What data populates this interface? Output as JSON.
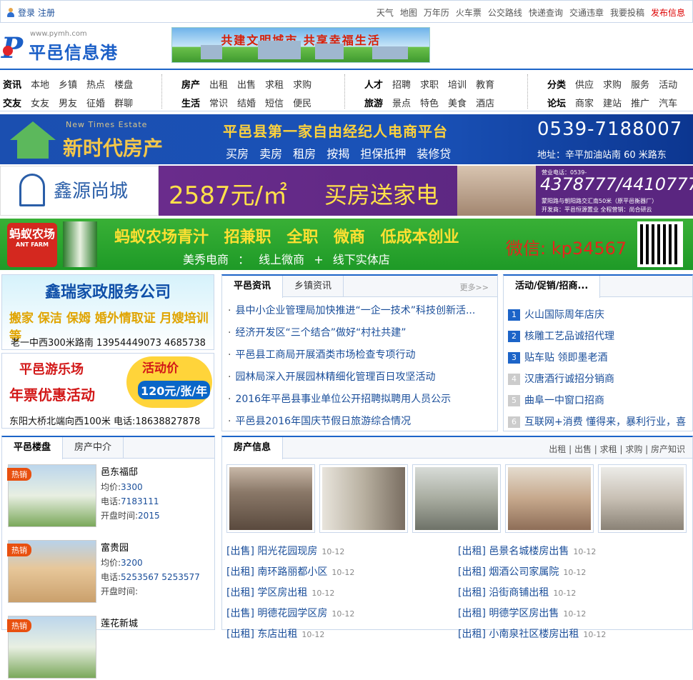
{
  "topbar": {
    "login": "登录",
    "register": "注册",
    "links": [
      "天气",
      "地图",
      "万年历",
      "火车票",
      "公交路线",
      "快递查询",
      "交通违章",
      "我要投稿"
    ],
    "publish": "发布信息"
  },
  "logo": {
    "url": "www.pymh.com",
    "name": "平邑信息港"
  },
  "slogan": "共建文明城市  共享幸福生活",
  "nav": {
    "g1": {
      "r1": [
        "资讯",
        "本地",
        "乡镇",
        "热点",
        "楼盘"
      ],
      "r2": [
        "交友",
        "女友",
        "男友",
        "征婚",
        "群聊"
      ]
    },
    "g2": {
      "r1": [
        "房产",
        "出租",
        "出售",
        "求租",
        "求购"
      ],
      "r2": [
        "生活",
        "常识",
        "结婚",
        "短信",
        "便民"
      ]
    },
    "g3": {
      "r1": [
        "人才",
        "招聘",
        "求职",
        "培训",
        "教育"
      ],
      "r2": [
        "旅游",
        "景点",
        "特色",
        "美食",
        "酒店"
      ]
    },
    "g4": {
      "r1": [
        "分类",
        "供应",
        "求购",
        "服务",
        "活动"
      ],
      "r2": [
        "论坛",
        "商家",
        "建站",
        "推广",
        "汽车"
      ]
    }
  },
  "banner1": {
    "eng": "New Times Estate",
    "name": "新时代房产",
    "headline": "平邑县第一家自由经纪人电商平台",
    "services": "买房 卖房 租房 按揭 担保抵押 装修贷",
    "phone": "0539-7188007",
    "address": "地址：辛平加油站南 60 米路东"
  },
  "banner2": {
    "name": "鑫源尚城",
    "price": "2587元/㎡",
    "gift": "买房送家电",
    "r1": "营业电话：0539-",
    "phones": "4378777/4410777",
    "r3": "蒙阳路与朝阳路交汇南50米（原平邑衡器厂）",
    "r4": "开发商：平邑恒源置业    全程营销：尚合研云"
  },
  "banner3": {
    "logo": "蚂蚁农场",
    "logo_en": "ANT FARM",
    "headline": "蚂蚁农场青汁 招兼职 全职 微商 低成本创业",
    "sub": "美秀电商 ： 线上微商 + 线下实体店",
    "wechat": "微信: kp34567"
  },
  "ad1": {
    "title": "鑫瑞家政服务公司",
    "services": "搬家 保洁 保姆 婚外情取证 月嫂培训 等",
    "address": "老一中西300米路南  13954449073 4685738"
  },
  "ad2": {
    "title": "平邑游乐场",
    "subtitle": "年票优惠活动",
    "badge": "活动价",
    "price": "120元/张/年",
    "address": "东阳大桥北端向西100米  电话:18638827878"
  },
  "news": {
    "tabs": [
      "平邑资讯",
      "乡镇资讯"
    ],
    "more": "更多>>",
    "items": [
      "县中小企业管理局加快推进“一企一技术”科技创新活...",
      "经济开发区“三个结合”做好“村社共建”",
      "平邑县工商局开展酒类市场检查专项行动",
      "园林局深入开展园林精细化管理百日攻坚活动",
      "2016年平邑县事业单位公开招聘拟聘用人员公示",
      "平邑县2016年国庆节假日旅游综合情况"
    ]
  },
  "promo": {
    "tab": "活动/促销/招商...",
    "items": [
      {
        "n": "1",
        "t": "火山国际周年店庆"
      },
      {
        "n": "2",
        "t": "核雕工艺品诚招代理"
      },
      {
        "n": "3",
        "t": "贴车贴 领即墨老酒"
      },
      {
        "n": "4",
        "t": "汉唐酒行诚招分销商"
      },
      {
        "n": "5",
        "t": "曲阜一中窗口招商"
      },
      {
        "n": "6",
        "t": "互联网+消费 懂得来，暴利行业，喜"
      }
    ]
  },
  "estate": {
    "tabs": [
      "平邑楼盘",
      "房产中介"
    ],
    "hot": "热销",
    "labels": {
      "price": "均价:",
      "phone": "电话:",
      "open": "开盘时间:"
    },
    "items": [
      {
        "name": "邑东福邸",
        "price": "3300",
        "phone": "7183111",
        "open": "2015"
      },
      {
        "name": "富贵园",
        "price": "3200",
        "phone": "5253567 5253577",
        "open": ""
      },
      {
        "name": "莲花新城",
        "price": "",
        "phone": "",
        "open": ""
      }
    ]
  },
  "house": {
    "tab": "房产信息",
    "links": "出租 | 出售 | 求租 | 求购 | 房产知识",
    "left": [
      {
        "type": "[出售]",
        "title": "阳光花园现房",
        "date": "10-12"
      },
      {
        "type": "[出租]",
        "title": "南环路丽都小区",
        "date": "10-12"
      },
      {
        "type": "[出租]",
        "title": "学区房出租",
        "date": "10-12"
      },
      {
        "type": "[出售]",
        "title": "明德花园学区房",
        "date": "10-12"
      },
      {
        "type": "[出租]",
        "title": "东店出租",
        "date": "10-12"
      }
    ],
    "right": [
      {
        "type": "[出租]",
        "title": "邑景名城楼房出售",
        "date": "10-12"
      },
      {
        "type": "[出租]",
        "title": "烟酒公司家属院",
        "date": "10-12"
      },
      {
        "type": "[出租]",
        "title": "沿街商铺出租",
        "date": "10-12"
      },
      {
        "type": "[出租]",
        "title": "明德学区房出售",
        "date": "10-12"
      },
      {
        "type": "[出租]",
        "title": "小南泉社区楼房出租",
        "date": "10-12"
      }
    ]
  }
}
